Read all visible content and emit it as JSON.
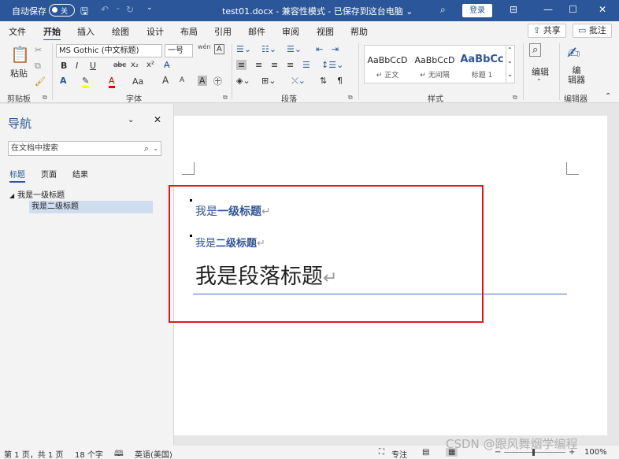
{
  "titlebar": {
    "autosave": "自动保存",
    "toggle": "关",
    "doc_title": "test01.docx  -  兼容性模式  -  已保存到这台电脑  ⌄",
    "login": "登录"
  },
  "menu": {
    "tabs": [
      "文件",
      "开始",
      "插入",
      "绘图",
      "设计",
      "布局",
      "引用",
      "邮件",
      "审阅",
      "视图",
      "帮助"
    ],
    "share": "共享",
    "comment": "批注"
  },
  "ribbon": {
    "paste": "粘贴",
    "clipboard_label": "剪贴板",
    "font_name": "MS Gothic (中文标题)",
    "font_size": "一号",
    "wen": "wén",
    "font_label": "字体",
    "bold": "B",
    "italic": "I",
    "underline": "U",
    "strike": "abc",
    "sub": "x₂",
    "sup": "x²",
    "case": "Aa",
    "grow": "A",
    "shrink": "A",
    "a_box": "A",
    "paragraph_label": "段落",
    "styles": [
      {
        "preview": "AaBbCcD",
        "name": "↵ 正文"
      },
      {
        "preview": "AaBbCcD",
        "name": "↵ 无间隔"
      },
      {
        "preview": "AaBbCc",
        "name": "标题 1"
      }
    ],
    "styles_label": "样式",
    "edit": "编辑",
    "editor": "编\n辑器",
    "editor_label": "编辑器"
  },
  "nav": {
    "title": "导航",
    "search_placeholder": "在文档中搜索",
    "tabs": [
      "标题",
      "页面",
      "结果"
    ],
    "tree": [
      {
        "label": "我是一级标题",
        "level": 1
      },
      {
        "label": "我是二级标题",
        "level": 2
      }
    ]
  },
  "document": {
    "h1_prefix": "我是",
    "h1_bold": "一级标题",
    "h2_prefix": "我是",
    "h2_bold": "二级标题",
    "para_title": "我是段落标题",
    "return_mark": "↵"
  },
  "status": {
    "page": "第 1 页，共 1 页",
    "words": "18 个字",
    "language": "英语(美国)",
    "focus": "专注",
    "zoom": "100%"
  },
  "watermark": "CSDN @跟风舞烟学编程",
  "colors": {
    "accent": "#2b579a",
    "heading": "#2f5496",
    "highlight_box": "#e0191f"
  }
}
